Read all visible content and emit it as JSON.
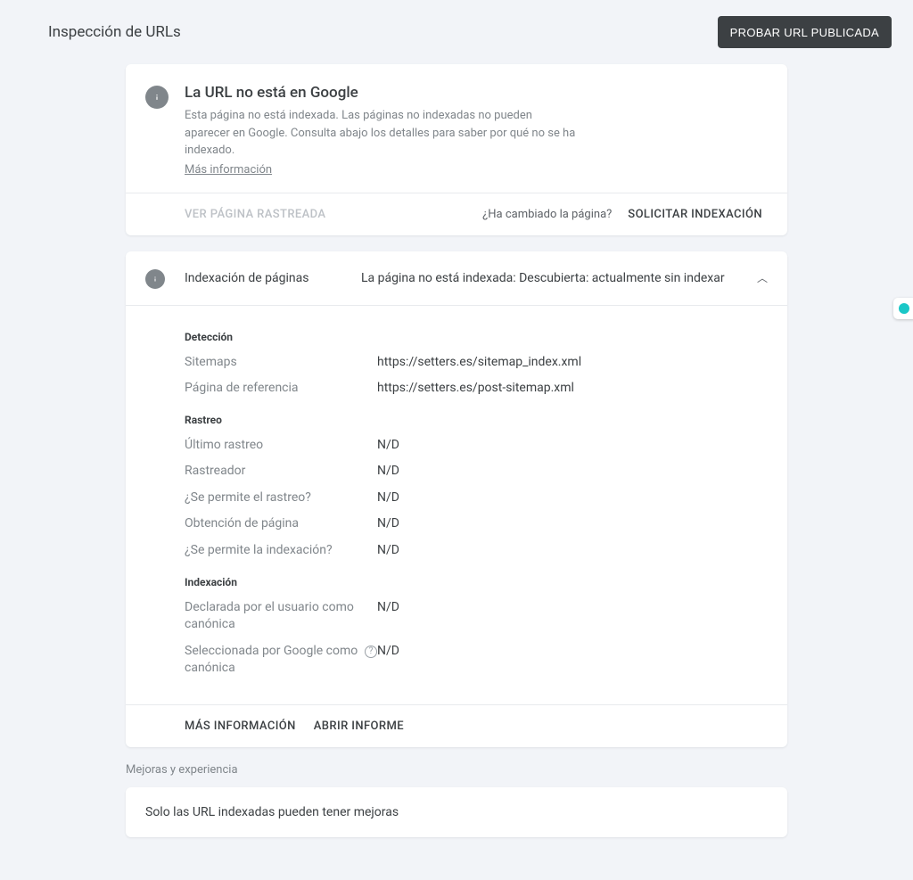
{
  "page": {
    "title": "Inspección de URLs",
    "test_live_button": "PROBAR URL PUBLICADA"
  },
  "status_card": {
    "heading": "La URL no está en Google",
    "description": "Esta página no está indexada. Las páginas no indexadas no pueden aparecer en Google. Consulta abajo los detalles para saber por qué no se ha indexado.",
    "more_info": "Más información",
    "view_crawled": "VER PÁGINA RASTREADA",
    "changed_q": "¿Ha cambiado la página?",
    "request_indexing": "SOLICITAR INDEXACIÓN"
  },
  "indexing": {
    "section_title": "Indexación de páginas",
    "section_status": "La página no está indexada: Descubierta: actualmente sin indexar",
    "groups": {
      "detection": {
        "title": "Detección",
        "rows": [
          {
            "label": "Sitemaps",
            "value": "https://setters.es/sitemap_index.xml"
          },
          {
            "label": "Página de referencia",
            "value": "https://setters.es/post-sitemap.xml"
          }
        ]
      },
      "crawl": {
        "title": "Rastreo",
        "rows": [
          {
            "label": "Último rastreo",
            "value": "N/D"
          },
          {
            "label": "Rastreador",
            "value": "N/D"
          },
          {
            "label": "¿Se permite el rastreo?",
            "value": "N/D"
          },
          {
            "label": "Obtención de página",
            "value": "N/D"
          },
          {
            "label": "¿Se permite la indexación?",
            "value": "N/D"
          }
        ]
      },
      "index": {
        "title": "Indexación",
        "rows": [
          {
            "label": "Declarada por el usuario como canónica",
            "value": "N/D",
            "help": false
          },
          {
            "label": "Seleccionada por Google como canónica",
            "value": "N/D",
            "help": true
          }
        ]
      }
    },
    "footer": {
      "more_info": "MÁS INFORMACIÓN",
      "open_report": "ABRIR INFORME"
    }
  },
  "enhancements": {
    "label": "Mejoras y experiencia",
    "message": "Solo las URL indexadas pueden tener mejoras"
  }
}
